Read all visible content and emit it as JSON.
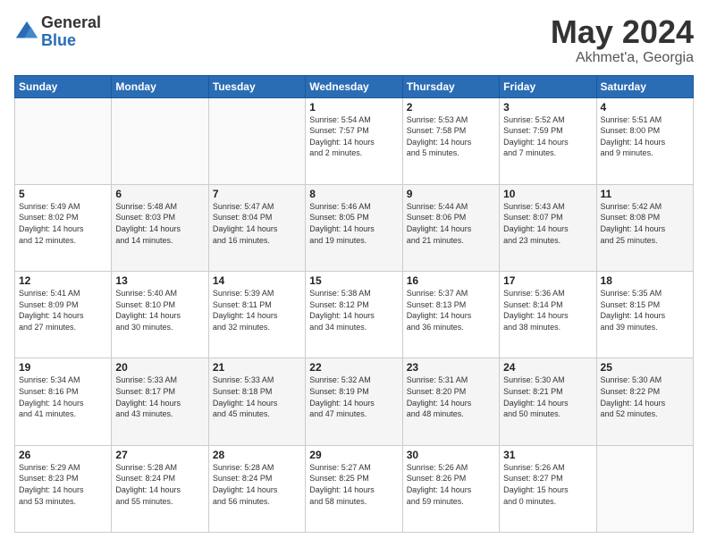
{
  "header": {
    "logo_general": "General",
    "logo_blue": "Blue",
    "month": "May 2024",
    "location": "Akhmet'a, Georgia"
  },
  "weekdays": [
    "Sunday",
    "Monday",
    "Tuesday",
    "Wednesday",
    "Thursday",
    "Friday",
    "Saturday"
  ],
  "weeks": [
    [
      {
        "day": "",
        "info": ""
      },
      {
        "day": "",
        "info": ""
      },
      {
        "day": "",
        "info": ""
      },
      {
        "day": "1",
        "info": "Sunrise: 5:54 AM\nSunset: 7:57 PM\nDaylight: 14 hours\nand 2 minutes."
      },
      {
        "day": "2",
        "info": "Sunrise: 5:53 AM\nSunset: 7:58 PM\nDaylight: 14 hours\nand 5 minutes."
      },
      {
        "day": "3",
        "info": "Sunrise: 5:52 AM\nSunset: 7:59 PM\nDaylight: 14 hours\nand 7 minutes."
      },
      {
        "day": "4",
        "info": "Sunrise: 5:51 AM\nSunset: 8:00 PM\nDaylight: 14 hours\nand 9 minutes."
      }
    ],
    [
      {
        "day": "5",
        "info": "Sunrise: 5:49 AM\nSunset: 8:02 PM\nDaylight: 14 hours\nand 12 minutes."
      },
      {
        "day": "6",
        "info": "Sunrise: 5:48 AM\nSunset: 8:03 PM\nDaylight: 14 hours\nand 14 minutes."
      },
      {
        "day": "7",
        "info": "Sunrise: 5:47 AM\nSunset: 8:04 PM\nDaylight: 14 hours\nand 16 minutes."
      },
      {
        "day": "8",
        "info": "Sunrise: 5:46 AM\nSunset: 8:05 PM\nDaylight: 14 hours\nand 19 minutes."
      },
      {
        "day": "9",
        "info": "Sunrise: 5:44 AM\nSunset: 8:06 PM\nDaylight: 14 hours\nand 21 minutes."
      },
      {
        "day": "10",
        "info": "Sunrise: 5:43 AM\nSunset: 8:07 PM\nDaylight: 14 hours\nand 23 minutes."
      },
      {
        "day": "11",
        "info": "Sunrise: 5:42 AM\nSunset: 8:08 PM\nDaylight: 14 hours\nand 25 minutes."
      }
    ],
    [
      {
        "day": "12",
        "info": "Sunrise: 5:41 AM\nSunset: 8:09 PM\nDaylight: 14 hours\nand 27 minutes."
      },
      {
        "day": "13",
        "info": "Sunrise: 5:40 AM\nSunset: 8:10 PM\nDaylight: 14 hours\nand 30 minutes."
      },
      {
        "day": "14",
        "info": "Sunrise: 5:39 AM\nSunset: 8:11 PM\nDaylight: 14 hours\nand 32 minutes."
      },
      {
        "day": "15",
        "info": "Sunrise: 5:38 AM\nSunset: 8:12 PM\nDaylight: 14 hours\nand 34 minutes."
      },
      {
        "day": "16",
        "info": "Sunrise: 5:37 AM\nSunset: 8:13 PM\nDaylight: 14 hours\nand 36 minutes."
      },
      {
        "day": "17",
        "info": "Sunrise: 5:36 AM\nSunset: 8:14 PM\nDaylight: 14 hours\nand 38 minutes."
      },
      {
        "day": "18",
        "info": "Sunrise: 5:35 AM\nSunset: 8:15 PM\nDaylight: 14 hours\nand 39 minutes."
      }
    ],
    [
      {
        "day": "19",
        "info": "Sunrise: 5:34 AM\nSunset: 8:16 PM\nDaylight: 14 hours\nand 41 minutes."
      },
      {
        "day": "20",
        "info": "Sunrise: 5:33 AM\nSunset: 8:17 PM\nDaylight: 14 hours\nand 43 minutes."
      },
      {
        "day": "21",
        "info": "Sunrise: 5:33 AM\nSunset: 8:18 PM\nDaylight: 14 hours\nand 45 minutes."
      },
      {
        "day": "22",
        "info": "Sunrise: 5:32 AM\nSunset: 8:19 PM\nDaylight: 14 hours\nand 47 minutes."
      },
      {
        "day": "23",
        "info": "Sunrise: 5:31 AM\nSunset: 8:20 PM\nDaylight: 14 hours\nand 48 minutes."
      },
      {
        "day": "24",
        "info": "Sunrise: 5:30 AM\nSunset: 8:21 PM\nDaylight: 14 hours\nand 50 minutes."
      },
      {
        "day": "25",
        "info": "Sunrise: 5:30 AM\nSunset: 8:22 PM\nDaylight: 14 hours\nand 52 minutes."
      }
    ],
    [
      {
        "day": "26",
        "info": "Sunrise: 5:29 AM\nSunset: 8:23 PM\nDaylight: 14 hours\nand 53 minutes."
      },
      {
        "day": "27",
        "info": "Sunrise: 5:28 AM\nSunset: 8:24 PM\nDaylight: 14 hours\nand 55 minutes."
      },
      {
        "day": "28",
        "info": "Sunrise: 5:28 AM\nSunset: 8:24 PM\nDaylight: 14 hours\nand 56 minutes."
      },
      {
        "day": "29",
        "info": "Sunrise: 5:27 AM\nSunset: 8:25 PM\nDaylight: 14 hours\nand 58 minutes."
      },
      {
        "day": "30",
        "info": "Sunrise: 5:26 AM\nSunset: 8:26 PM\nDaylight: 14 hours\nand 59 minutes."
      },
      {
        "day": "31",
        "info": "Sunrise: 5:26 AM\nSunset: 8:27 PM\nDaylight: 15 hours\nand 0 minutes."
      },
      {
        "day": "",
        "info": ""
      }
    ]
  ]
}
